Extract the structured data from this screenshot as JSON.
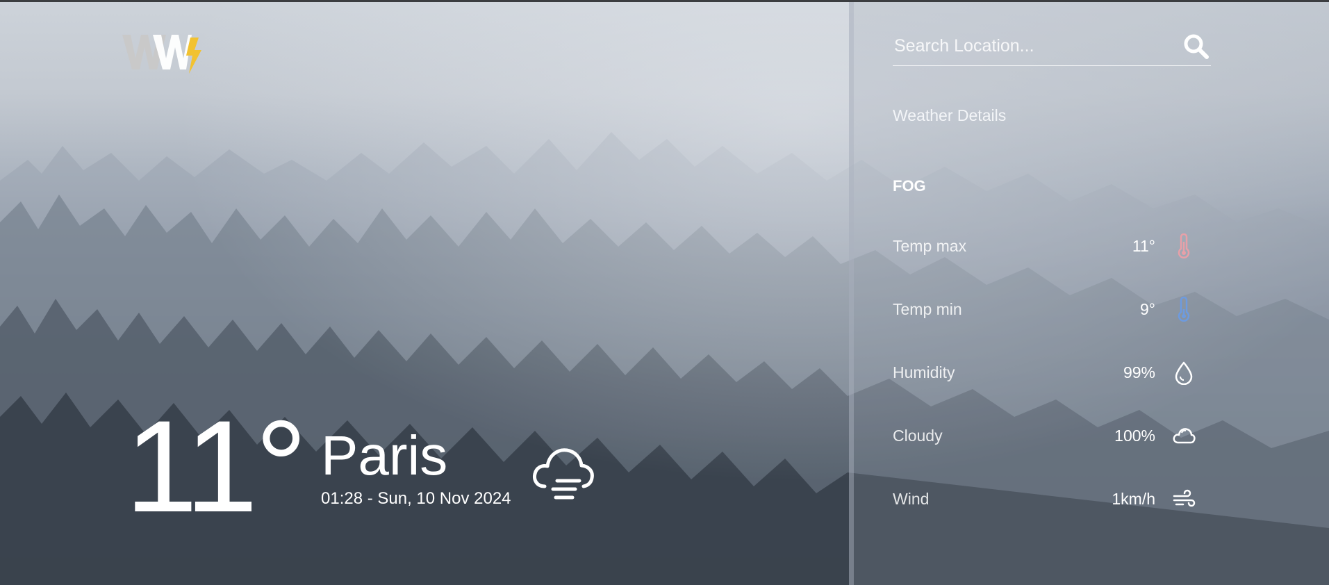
{
  "search": {
    "placeholder": "Search Location..."
  },
  "current": {
    "temperature": "11°",
    "city": "Paris",
    "datetime": "01:28 - Sun, 10 Nov 2024",
    "condition_icon": "fog-cloud-icon"
  },
  "details": {
    "title": "Weather Details",
    "condition": "FOG",
    "rows": [
      {
        "label": "Temp max",
        "value": "11°",
        "icon": "thermometer-hot-icon"
      },
      {
        "label": "Temp min",
        "value": "9°",
        "icon": "thermometer-cold-icon"
      },
      {
        "label": "Humidity",
        "value": "99%",
        "icon": "droplet-icon"
      },
      {
        "label": "Cloudy",
        "value": "100%",
        "icon": "cloud-icon"
      },
      {
        "label": "Wind",
        "value": "1km/h",
        "icon": "wind-icon"
      }
    ]
  },
  "colors": {
    "logo_gray": "#c9c9c9",
    "logo_white": "#ffffff",
    "logo_accent": "#f2c230",
    "temp_max_icon": "#e8a0a8",
    "temp_min_icon": "#6d9be0"
  }
}
